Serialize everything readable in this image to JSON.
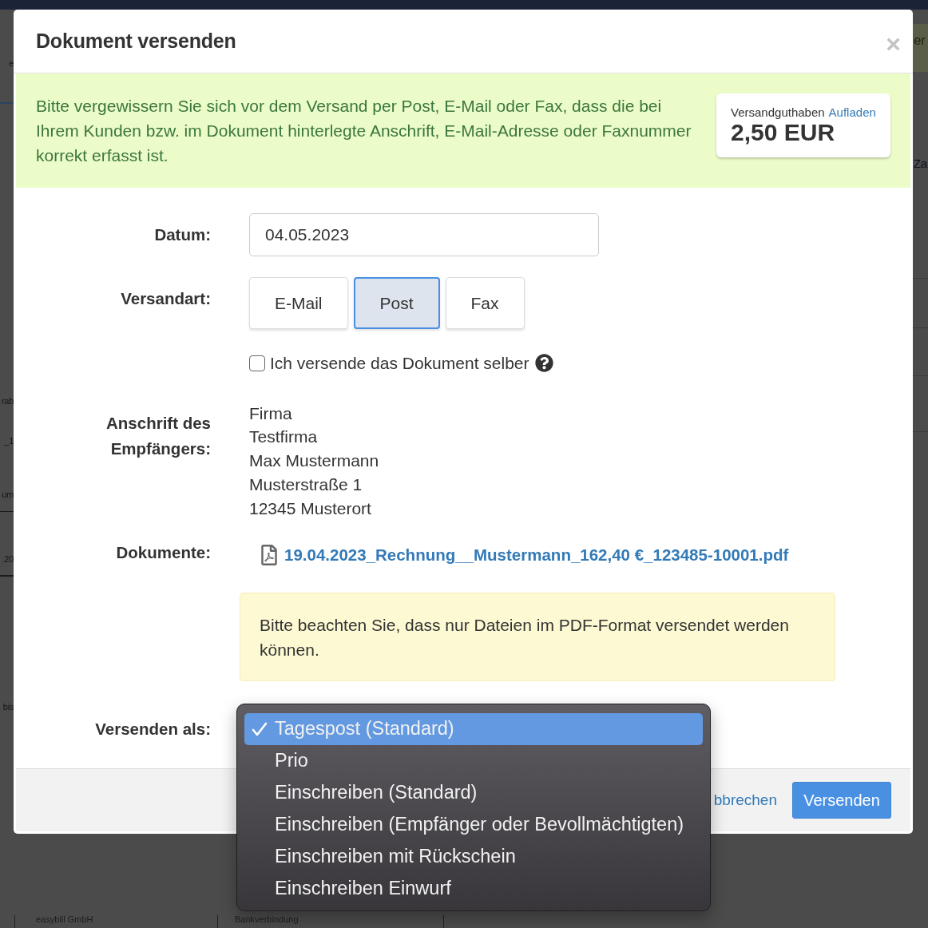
{
  "background": {
    "left_fragments": [
      "e",
      "rab",
      "_1",
      "um",
      ".20",
      "bis"
    ],
    "right_fragments": [
      "er",
      "Za"
    ],
    "footer": [
      "easybill GmbH",
      "Bankverbindung"
    ]
  },
  "dialog": {
    "title": "Dokument versenden",
    "close": "×"
  },
  "notice": {
    "text": "Bitte vergewissern Sie sich vor dem Versand per Post, E-Mail oder Fax, dass die bei Ihrem Kunden bzw. im Dokument hinterlegte Anschrift, E-Mail-Adresse oder Faxnummer korrekt erfasst ist.",
    "balance": {
      "label": "Versandguthaben",
      "link": "Aufladen",
      "amount": "2,50 EUR"
    }
  },
  "form": {
    "date": {
      "label": "Datum:",
      "value": "04.05.2023"
    },
    "shipping_method": {
      "label": "Versandart:",
      "options": [
        {
          "label": "E-Mail",
          "selected": false
        },
        {
          "label": "Post",
          "selected": true
        },
        {
          "label": "Fax",
          "selected": false
        }
      ]
    },
    "self_send": {
      "label": "Ich versende das Dokument selber",
      "checked": false
    },
    "address": {
      "label": "Anschrift des Empfängers:",
      "lines": [
        "Firma",
        "Testfirma",
        "Max Mustermann",
        "Musterstraße 1",
        "12345 Musterort"
      ]
    },
    "documents": {
      "label": "Dokumente:",
      "files": [
        "19.04.2023_Rechnung__Mustermann_162,40 €_123485-10001.pdf"
      ]
    },
    "pdf_note": "Bitte beachten Sie, dass nur Dateien im PDF-Format versendet werden können.",
    "send_as": {
      "label": "Versenden als:",
      "options": [
        {
          "label": "Tagespost (Standard)",
          "selected": true
        },
        {
          "label": "Prio",
          "selected": false
        },
        {
          "label": "Einschreiben (Standard)",
          "selected": false
        },
        {
          "label": "Einschreiben (Empfänger oder Bevollmächtigten)",
          "selected": false
        },
        {
          "label": "Einschreiben mit Rückschein",
          "selected": false
        },
        {
          "label": "Einschreiben Einwurf",
          "selected": false
        }
      ]
    }
  },
  "footer": {
    "cancel": "bbrechen",
    "submit": "Versenden"
  }
}
